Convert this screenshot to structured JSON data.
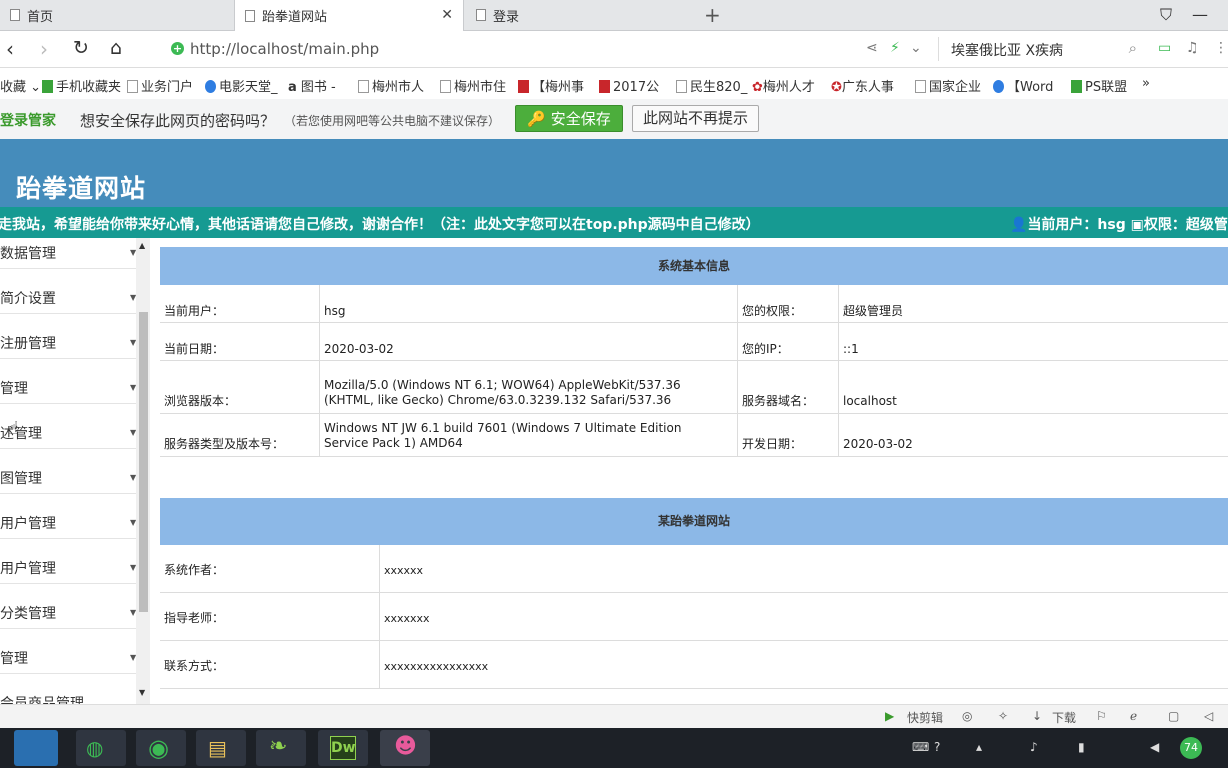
{
  "browser": {
    "tabs": [
      {
        "label": "首页",
        "active": false
      },
      {
        "label": "跆拳道网站",
        "active": true
      },
      {
        "label": "登录",
        "active": false
      }
    ],
    "url": "http://localhost/main.php",
    "search_text": "埃塞俄比亚 X疾病",
    "bookmarks": [
      "收藏",
      "手机收藏夹",
      "业务门户",
      "电影天堂_",
      "图书 -",
      "梅州市人",
      "梅州市住",
      "【梅州事",
      "2017公",
      "民生820_",
      "梅州人才",
      "广东人事",
      "国家企业",
      "【Word",
      "PS联盟",
      "»"
    ],
    "password_bar": {
      "brand": "登录管家",
      "question": "想安全保存此网页的密码吗？",
      "note": "（若您使用网吧等公共电脑不建议保存）",
      "save_label": "安全保存",
      "never_label": "此网站不再提示"
    }
  },
  "site": {
    "title": "跆拳道网站",
    "marquee": "走我站，希望能给你带来好心情，其他话语请您自己修改，谢谢合作！（注：此处文字您可以在top.php源码中自己修改）",
    "user_label": "当前用户：hsg",
    "role_label": "权限：超级管理"
  },
  "sidebar": {
    "items": [
      "数据管理",
      "简介设置",
      "注册管理",
      "管理",
      "述管理",
      "图管理",
      "用户管理",
      "用户管理",
      "分类管理",
      "管理",
      "会员商品管理"
    ]
  },
  "system_info": {
    "header": "系统基本信息",
    "rows": [
      {
        "label1": "当前用户：",
        "value1": "hsg",
        "label2": "您的权限：",
        "value2": "超级管理员"
      },
      {
        "label1": "当前日期：",
        "value1": "2020-03-02",
        "label2": "您的IP：",
        "value2": "::1"
      },
      {
        "label1": "浏览器版本：",
        "value1": "Mozilla/5.0 (Windows NT 6.1; WOW64) AppleWebKit/537.36 (KHTML, like Gecko) Chrome/63.0.3239.132 Safari/537.36",
        "label2": "服务器域名：",
        "value2": "localhost"
      },
      {
        "label1": "服务器类型及版本号：",
        "value1": "Windows NT JW 6.1 build 7601 (Windows 7 Ultimate Edition Service Pack 1) AMD64",
        "label2": "开发日期：",
        "value2": "2020-03-02"
      }
    ]
  },
  "site_info": {
    "header": "某跆拳道网站",
    "rows": [
      {
        "label": "系统作者：",
        "value": "xxxxxx"
      },
      {
        "label": "指导老师：",
        "value": "xxxxxxx"
      },
      {
        "label": "联系方式：",
        "value": "xxxxxxxxxxxxxxxx"
      }
    ]
  },
  "statusbar": {
    "quick_cut": "快剪辑",
    "download": "下载"
  },
  "taskbar": {
    "badge": "74"
  },
  "colors": {
    "header_blue": "#458cbb",
    "marquee_teal": "#169a92",
    "table_header": "#8cb8e7",
    "save_green": "#4cae3c"
  }
}
